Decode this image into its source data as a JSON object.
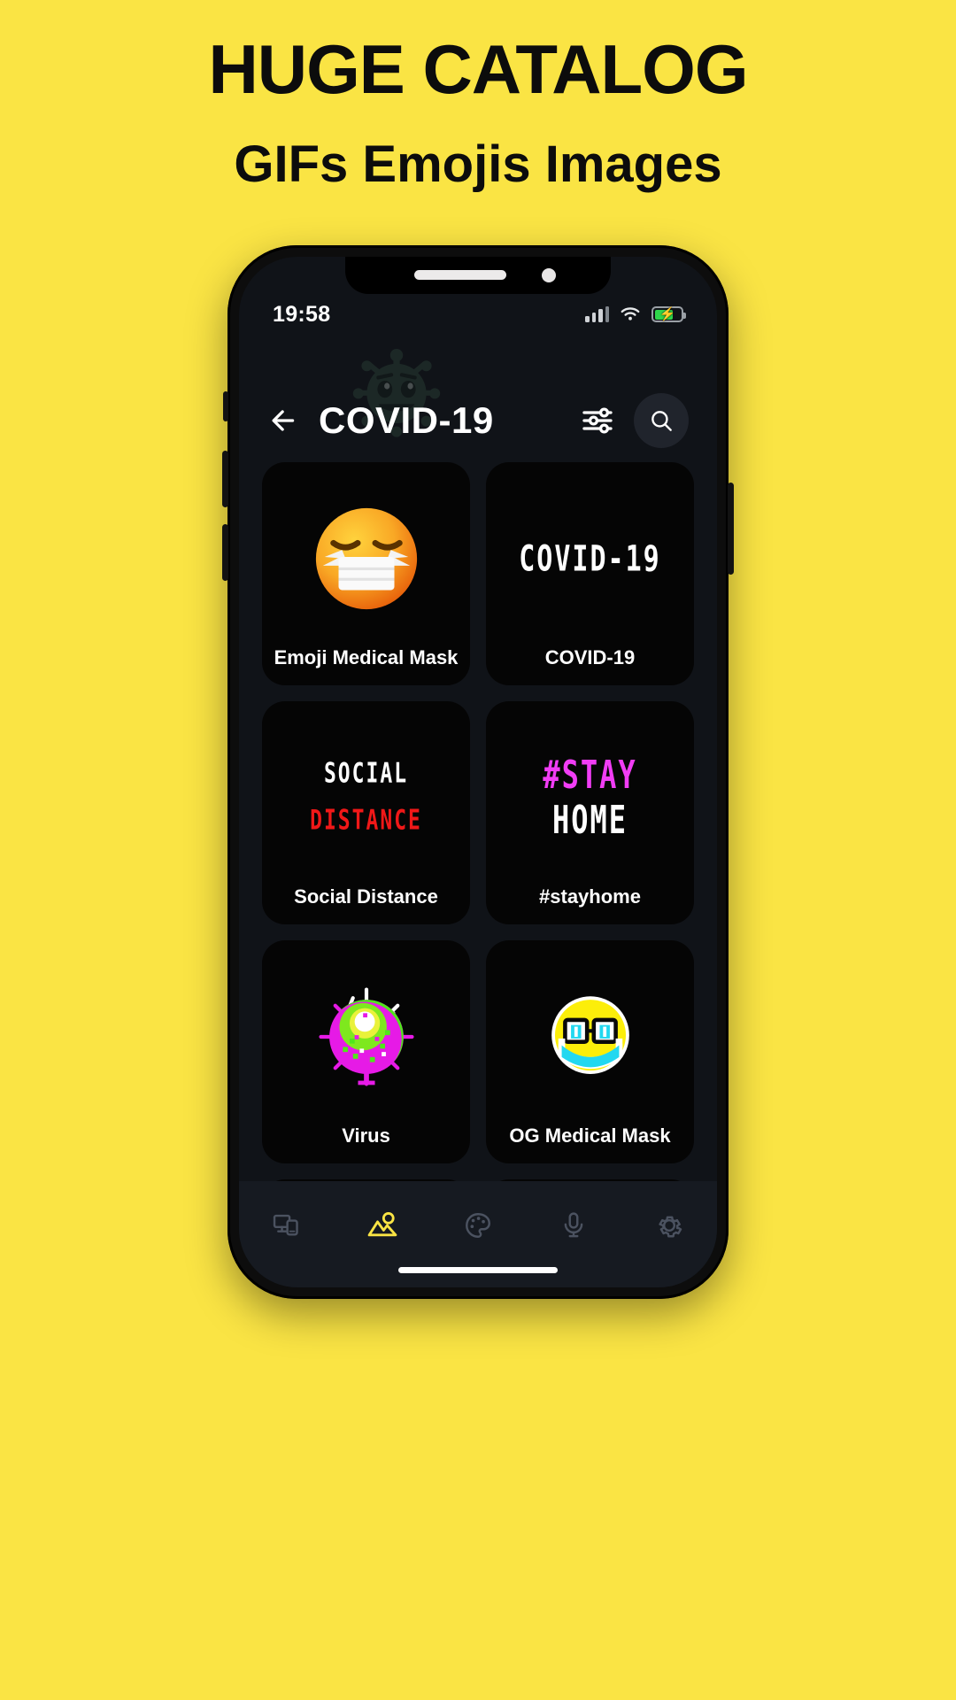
{
  "promo": {
    "title": "HUGE CATALOG",
    "subtitle": "GIFs Emojis Images",
    "background_color": "#FAE444",
    "text_color": "#0c0c0c"
  },
  "phone": {
    "status_bar": {
      "time": "19:58",
      "signal_icon": "signal-bars-icon",
      "wifi_icon": "wifi-icon",
      "battery_icon": "battery-charging-icon",
      "battery_charging": true
    },
    "home_indicator": "home-indicator"
  },
  "app": {
    "header": {
      "back_icon": "back-arrow-icon",
      "title": "COVID-19",
      "filter_icon": "filter-sliders-icon",
      "search_icon": "search-icon",
      "watermark_icon": "virus-emoji-watermark"
    },
    "accent_color": "#FAE444",
    "card_bg": "#050505",
    "screen_bg": "#101318",
    "grid": [
      {
        "label": "Emoji Medical Mask",
        "art": "emoji-medical-mask"
      },
      {
        "label": "COVID-19",
        "art": "led-text-covid19",
        "art_text": "COVID-19"
      },
      {
        "label": "Social Distance",
        "art": "led-text-social-distance",
        "art_text_1": "SOCIAL",
        "art_text_2": "DISTANCE"
      },
      {
        "label": "#stayhome",
        "art": "led-text-stayhome",
        "art_text_1": "#STAY",
        "art_text_2": "HOME"
      },
      {
        "label": "Virus",
        "art": "pixel-virus"
      },
      {
        "label": "OG Medical Mask",
        "art": "pixel-og-medical-mask"
      }
    ],
    "tabs": [
      {
        "name": "devices",
        "icon": "devices-icon",
        "active": false
      },
      {
        "name": "images",
        "icon": "image-mountain-icon",
        "active": true
      },
      {
        "name": "themes",
        "icon": "palette-icon",
        "active": false
      },
      {
        "name": "voice",
        "icon": "microphone-icon",
        "active": false
      },
      {
        "name": "settings",
        "icon": "gear-icon",
        "active": false
      }
    ]
  }
}
